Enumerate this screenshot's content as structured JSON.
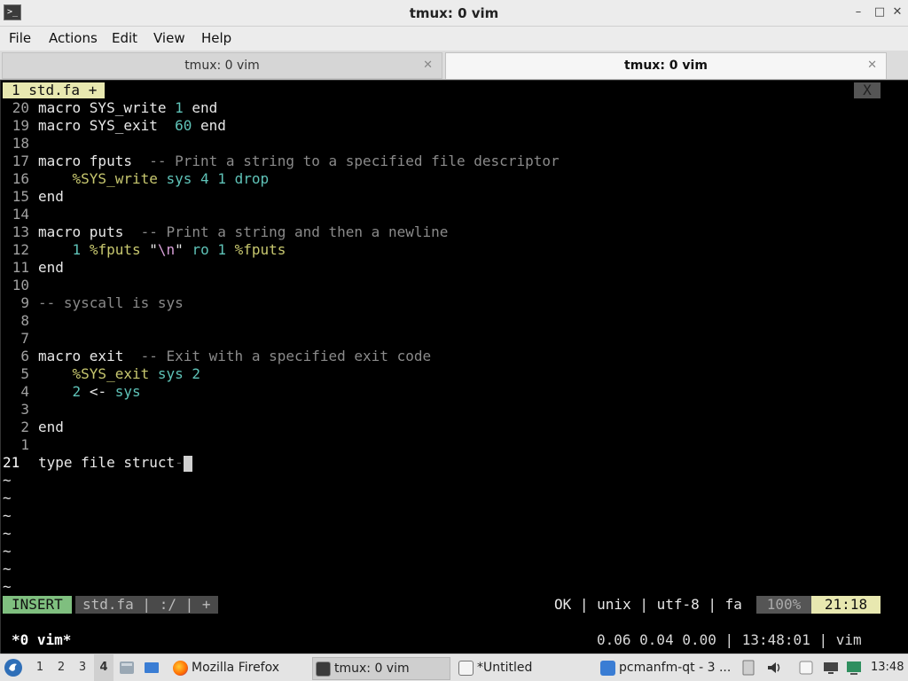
{
  "window": {
    "title": "tmux: 0 vim",
    "app_icon": ">_",
    "minimize_symbol": "–",
    "maximize_symbol": "□",
    "close_symbol": "✕"
  },
  "menu": [
    "File",
    "Actions",
    "Edit",
    "View",
    "Help"
  ],
  "tabs": [
    {
      "label": "tmux: 0 vim",
      "active": false
    },
    {
      "label": "tmux: 0 vim",
      "active": true
    }
  ],
  "tab_close_symbol": "✕",
  "vim": {
    "tab_label": "1 std.fa +",
    "tab_close": "X",
    "mode": "INSERT",
    "file_info": "std.fa | :/ | +",
    "right_info": "OK | unix | utf-8 | fa",
    "percent": "100%",
    "position": "21:18"
  },
  "tmux": {
    "window_label": "*0 vim*",
    "status_right": "0.06 0.04 0.00 | 13:48:01 | vim"
  },
  "taskbar": {
    "workspaces": [
      "1",
      "2",
      "3",
      "4"
    ],
    "active_workspace": "4",
    "tasks": [
      {
        "label": "Mozilla Firefox",
        "icon": "firefox-icon"
      },
      {
        "label": "tmux: 0 vim",
        "icon": "terminal-icon",
        "active": true
      },
      {
        "label": "*Untitled",
        "icon": "text-editor-icon"
      },
      {
        "label": "pcmanfm-qt - 3 ...",
        "icon": "folder-icon"
      }
    ],
    "clock": "13:48"
  },
  "colors": {
    "insert_mode": "#7fbf7f",
    "vim_tab": "#e8e8b0",
    "terminal_bg": "#000000",
    "number": "#5fc3b8"
  }
}
